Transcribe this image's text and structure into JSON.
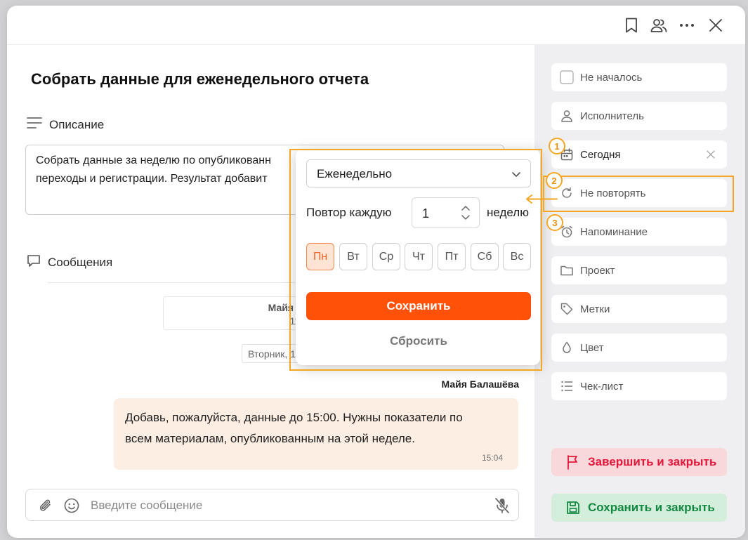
{
  "task": {
    "title": "Собрать данные для еженедельного отчета"
  },
  "description": {
    "heading": "Описание",
    "line1": "Собрать данные за неделю по опубликованн",
    "line2": "переходы и регистрации. Результат добавит"
  },
  "messages": {
    "heading": "Сообщения",
    "system_author": "Майя Балашёва со",
    "system_date": "11.08.2026",
    "day_chip": "Вторник, 1",
    "author": "Майя Балашёва",
    "bubble_line1": "Добавь, пожалуйста, данные до 15:00. Нужны показатели по",
    "bubble_line2": "всем материалам, опубликованным на этой неделе.",
    "time": "15:04"
  },
  "composer": {
    "placeholder": "Введите сообщение"
  },
  "sidebar": {
    "items": [
      {
        "label": "Не началось",
        "icon": "checkbox-icon"
      },
      {
        "label": "Исполнитель",
        "icon": "person-icon"
      },
      {
        "label": "Сегодня",
        "icon": "calendar-icon"
      },
      {
        "label": "Не повторять",
        "icon": "repeat-icon"
      },
      {
        "label": "Напоминание",
        "icon": "alarm-icon"
      },
      {
        "label": "Проект",
        "icon": "folder-icon"
      },
      {
        "label": "Метки",
        "icon": "tag-icon"
      },
      {
        "label": "Цвет",
        "icon": "droplet-icon"
      },
      {
        "label": "Чек-лист",
        "icon": "checklist-icon"
      }
    ],
    "finish_label": "Завершить и закрыть",
    "save_label": "Сохранить и закрыть"
  },
  "repeat_popup": {
    "frequency": "Еженедельно",
    "repeat_label": "Повтор каждую",
    "interval": "1",
    "unit": "неделю",
    "days": [
      "Пн",
      "Вт",
      "Ср",
      "Чт",
      "Пт",
      "Сб",
      "Вс"
    ],
    "selected_day": "Пн",
    "save": "Сохранить",
    "reset": "Сбросить"
  },
  "annotations": [
    "1",
    "2",
    "3"
  ],
  "colors": {
    "accent": "#ff5108",
    "annotation": "#f5a623",
    "finish": "#e4173a",
    "save": "#138841"
  }
}
